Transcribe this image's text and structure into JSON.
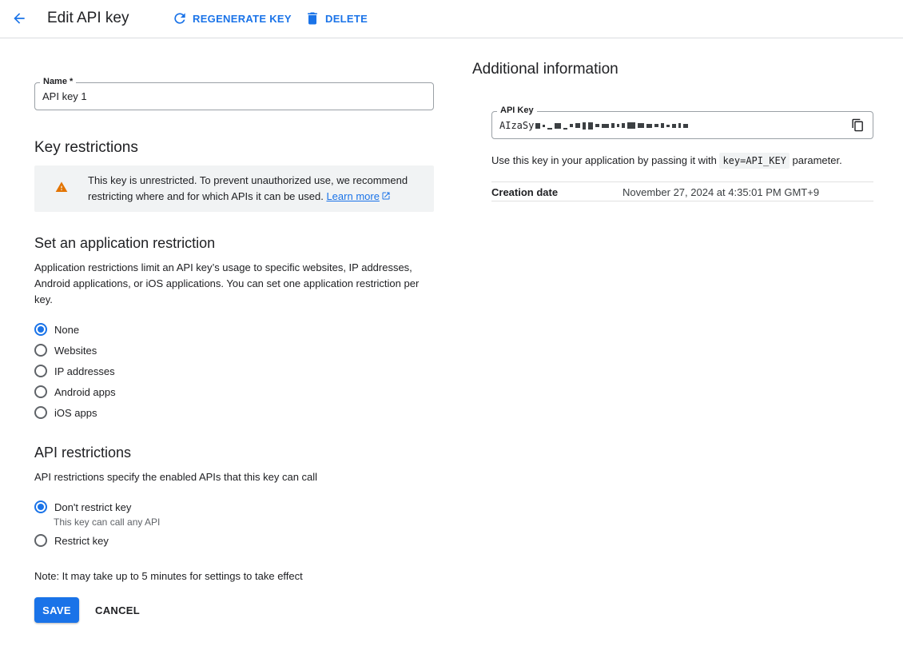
{
  "header": {
    "title": "Edit API key",
    "regenerate_label": "REGENERATE KEY",
    "delete_label": "DELETE"
  },
  "name_field": {
    "label": "Name *",
    "value": "API key 1"
  },
  "key_restrictions": {
    "heading": "Key restrictions",
    "warning_text": "This key is unrestricted. To prevent unauthorized use, we recommend restricting where and for which APIs it can be used.",
    "learn_more": "Learn more"
  },
  "app_restriction": {
    "heading": "Set an application restriction",
    "description": "Application restrictions limit an API key’s usage to specific websites, IP addresses, Android applications, or iOS applications. You can set one application restriction per key.",
    "options": [
      {
        "label": "None",
        "selected": true
      },
      {
        "label": "Websites",
        "selected": false
      },
      {
        "label": "IP addresses",
        "selected": false
      },
      {
        "label": "Android apps",
        "selected": false
      },
      {
        "label": "iOS apps",
        "selected": false
      }
    ]
  },
  "api_restrictions": {
    "heading": "API restrictions",
    "description": "API restrictions specify the enabled APIs that this key can call",
    "options": [
      {
        "label": "Don't restrict key",
        "hint": "This key can call any API",
        "selected": true
      },
      {
        "label": "Restrict key",
        "selected": false
      }
    ]
  },
  "note": "Note: It may take up to 5 minutes for settings to take effect",
  "actions": {
    "save": "SAVE",
    "cancel": "CANCEL"
  },
  "additional_info": {
    "heading": "Additional information",
    "api_key_label": "API Key",
    "api_key_prefix": "AIzaSy",
    "usage_prefix": "Use this key in your application by passing it with",
    "usage_code": "key=API_KEY",
    "usage_suffix": "parameter.",
    "creation_label": "Creation date",
    "creation_value": "November 27, 2024 at 4:35:01 PM GMT+9"
  },
  "colors": {
    "accent": "#1a73e8",
    "warning": "#e37400"
  }
}
